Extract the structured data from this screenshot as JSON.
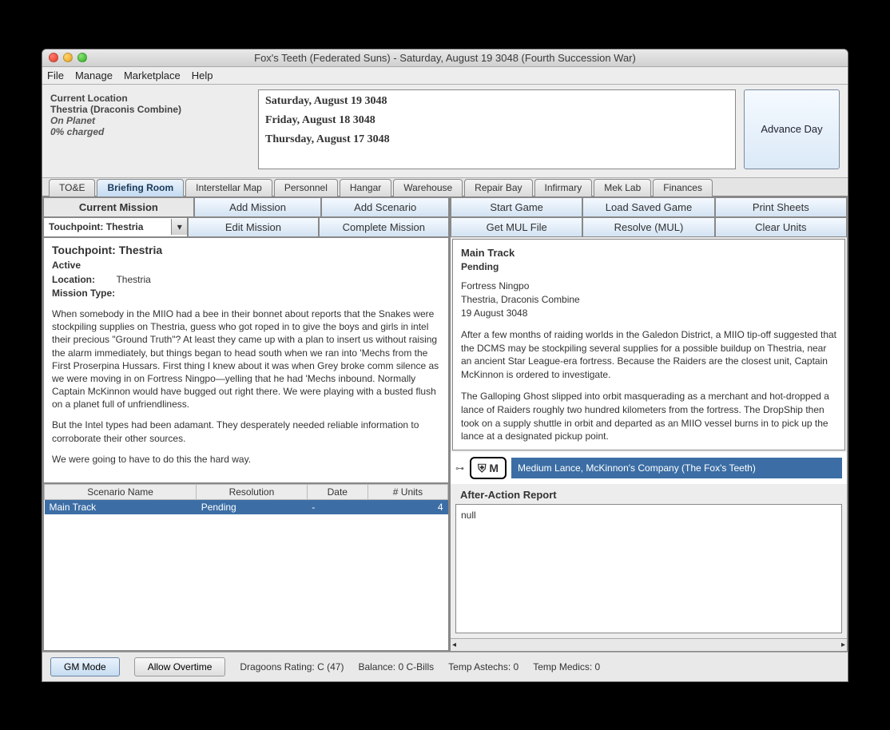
{
  "window": {
    "title": "Fox's Teeth (Federated Suns) - Saturday, August 19 3048 (Fourth Succession War)"
  },
  "menu": {
    "file": "File",
    "manage": "Manage",
    "marketplace": "Marketplace",
    "help": "Help"
  },
  "location": {
    "heading": "Current Location",
    "place": "Thestria (Draconis Combine)",
    "status": "On Planet",
    "charge": "0% charged"
  },
  "log": {
    "d0": "Saturday, August 19 3048",
    "d1": "Friday, August 18 3048",
    "d2": "Thursday, August 17 3048"
  },
  "advance_day": "Advance Day",
  "tabs": {
    "toe": "TO&E",
    "briefing": "Briefing Room",
    "map": "Interstellar Map",
    "personnel": "Personnel",
    "hangar": "Hangar",
    "warehouse": "Warehouse",
    "repair": "Repair Bay",
    "infirmary": "Infirmary",
    "meklab": "Mek Lab",
    "finances": "Finances"
  },
  "mission_bar": {
    "current": "Current Mission",
    "add_mission": "Add Mission",
    "add_scenario": "Add Scenario",
    "edit_mission": "Edit Mission",
    "complete_mission": "Complete Mission",
    "selected": "Touchpoint: Thestria"
  },
  "game_bar": {
    "start": "Start Game",
    "load": "Load Saved Game",
    "print": "Print Sheets",
    "mul": "Get MUL File",
    "resolve": "Resolve (MUL)",
    "clear": "Clear Units"
  },
  "mission": {
    "title": "Touchpoint: Thestria",
    "status_label": "Active",
    "loc_label": "Location:",
    "loc_val": "Thestria",
    "type_label": "Mission Type:",
    "p1": "When somebody in the MIIO had a bee in their bonnet about reports that the Snakes were stockpiling supplies on Thestria, guess who got roped in to give the boys and girls in intel their precious \"Ground Truth\"? At least they came up with a plan to insert us without raising the alarm immediately, but things began to head south when we ran into 'Mechs from the First Proserpina Hussars. First thing I knew about it was when Grey broke comm silence as we were moving in on Fortress Ningpo—yelling that he had 'Mechs inbound. Normally Captain McKinnon would have bugged out right there. We were playing with a busted flush on a planet full of unfriendliness.",
    "p2": "But the Intel types had been adamant. They desperately needed reliable information to corroborate their other sources.",
    "p3": "We were going to have to do this the hard way."
  },
  "scenario_table": {
    "h0": "Scenario Name",
    "h1": "Resolution",
    "h2": "Date",
    "h3": "# Units",
    "r0c0": "Main Track",
    "r0c1": "Pending",
    "r0c2": "-",
    "r0c3": "4"
  },
  "track": {
    "title": "Main Track",
    "status": "Pending",
    "l1": "Fortress Ningpo",
    "l2": "Thestria, Draconis Combine",
    "l3": "19 August 3048",
    "p1": "After a few months of raiding worlds in the Galedon District, a MIIO tip-off suggested that the DCMS may be stockpiling several supplies for a possible buildup on Thestria, near an ancient Star League-era fortress. Because the Raiders are the closest unit, Captain McKinnon is ordered to investigate.",
    "p2": "The Galloping Ghost slipped into orbit masquerading as a merchant and hot-dropped a lance of Raiders roughly two hundred kilometers from the fortress. The DropShip then took on a supply shuttle in orbit and departed as an MIIO vessel burns in to pick up the lance at a designated pickup point."
  },
  "unit": {
    "icon": "⛨ M",
    "label": "Medium Lance, McKinnon's Company (The Fox's Teeth)"
  },
  "aar": {
    "label": "After-Action Report",
    "value": "null"
  },
  "status": {
    "gm": "GM Mode",
    "overtime": "Allow Overtime",
    "dragoons": "Dragoons Rating: C (47)",
    "balance": "Balance: 0 C-Bills",
    "astechs": "Temp Astechs: 0",
    "medics": "Temp Medics: 0"
  }
}
